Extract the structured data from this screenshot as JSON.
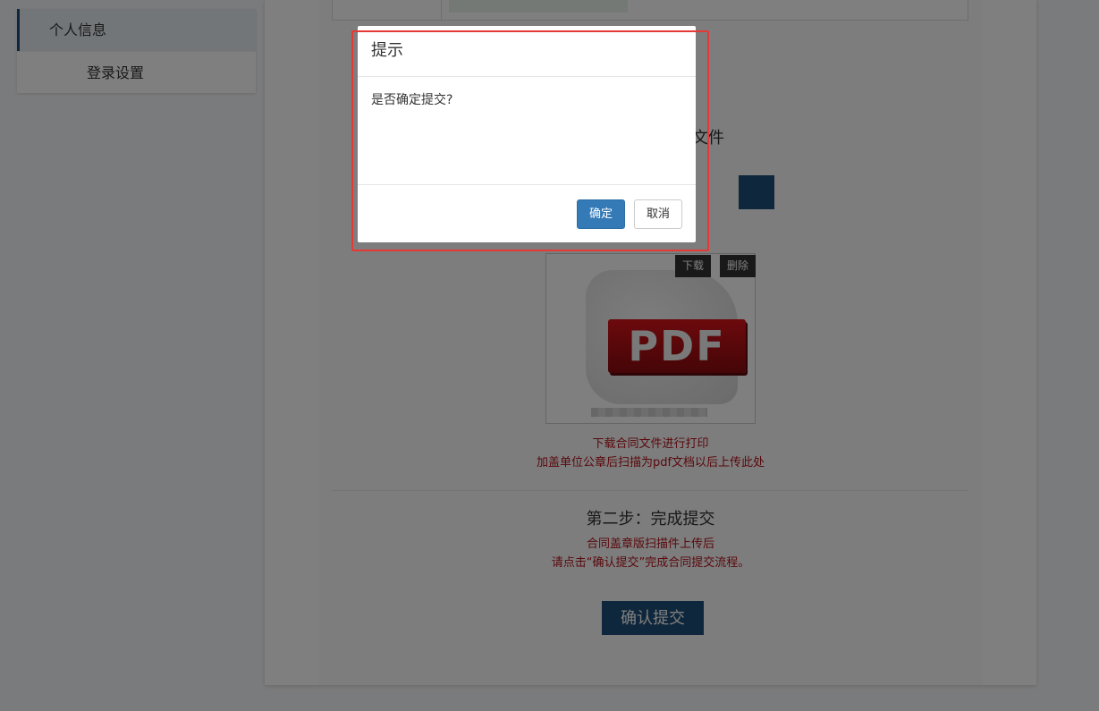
{
  "sidebar": {
    "items": [
      {
        "label": "个人信息",
        "active": true
      },
      {
        "label": "登录设置",
        "active": false
      }
    ]
  },
  "main": {
    "section1_title_partial": "同文件",
    "file_card": {
      "download_label": "下载",
      "delete_label": "删除",
      "badge_text": "PDF"
    },
    "note1_line1": "下载合同文件进行打印",
    "note1_line2": "加盖单位公章后扫描为pdf文档以后上传此处",
    "step2_title": "第二步：完成提交",
    "note2_line1": "合同盖章版扫描件上传后",
    "note2_line2": "请点击“确认提交”完成合同提交流程。",
    "confirm_submit_label": "确认提交"
  },
  "dialog": {
    "title": "提示",
    "message": "是否确定提交?",
    "ok_label": "确定",
    "cancel_label": "取消"
  },
  "colors": {
    "brand": "#1f4e79",
    "note_red": "#b5121b",
    "highlight": "#e53935",
    "ok_button": "#337ab7"
  }
}
